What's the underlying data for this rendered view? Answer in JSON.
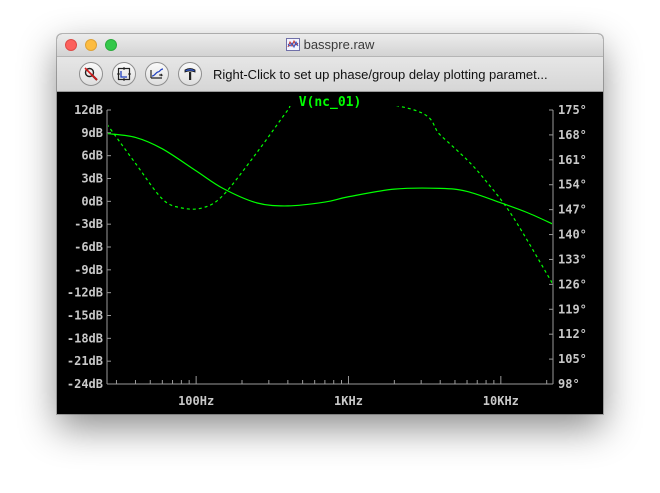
{
  "window": {
    "title": "basspre.raw"
  },
  "toolbar": {
    "buttons": [
      "autorange-button",
      "zoom-extents-button",
      "pan-button",
      "probe-button"
    ],
    "hint": "Right-Click to set up phase/group delay plotting paramet..."
  },
  "colors": {
    "trace": "#00ff00",
    "axis_text": "#c8c8c8",
    "background": "#000000"
  },
  "chart_data": {
    "type": "line",
    "title": "V(nc_01)",
    "x_scale": "log",
    "xlim": [
      26,
      22000
    ],
    "x_ticks": [
      {
        "value": 100,
        "label": "100Hz"
      },
      {
        "value": 1000,
        "label": "1KHz"
      },
      {
        "value": 10000,
        "label": "10KHz"
      }
    ],
    "y_left": {
      "ylim": [
        -24,
        12
      ],
      "ticks": [
        "12dB",
        "9dB",
        "6dB",
        "3dB",
        "0dB",
        "-3dB",
        "-6dB",
        "-9dB",
        "-12dB",
        "-15dB",
        "-18dB",
        "-21dB",
        "-24dB"
      ],
      "values": [
        12,
        9,
        6,
        3,
        0,
        -3,
        -6,
        -9,
        -12,
        -15,
        -18,
        -21,
        -24
      ]
    },
    "y_right": {
      "ylim": [
        98,
        175
      ],
      "ticks": [
        "175°",
        "168°",
        "161°",
        "154°",
        "147°",
        "140°",
        "133°",
        "126°",
        "119°",
        "112°",
        "105°",
        "98°"
      ],
      "values": [
        175,
        168,
        161,
        154,
        147,
        140,
        133,
        126,
        119,
        112,
        105,
        98
      ]
    },
    "grid": false,
    "series": [
      {
        "style": "solid",
        "axis": "left",
        "unit": "dB",
        "x": [
          26,
          40,
          60,
          100,
          150,
          250,
          400,
          700,
          1000,
          2000,
          4000,
          6000,
          10000,
          15000,
          22000
        ],
        "y": [
          8.9,
          8.4,
          6.9,
          4.0,
          1.7,
          -0.2,
          -0.6,
          -0.1,
          0.6,
          1.6,
          1.7,
          1.3,
          -0.2,
          -1.5,
          -3.0
        ]
      },
      {
        "style": "dashed",
        "axis": "right",
        "unit": "deg",
        "x": [
          26,
          40,
          60,
          80,
          110,
          150,
          250,
          400,
          500,
          2700,
          4000,
          6000,
          8000,
          12000,
          22000
        ],
        "y": [
          171,
          160,
          150,
          147.5,
          147.5,
          151,
          163,
          175,
          180,
          175,
          168,
          161,
          155,
          145,
          126
        ]
      }
    ]
  }
}
